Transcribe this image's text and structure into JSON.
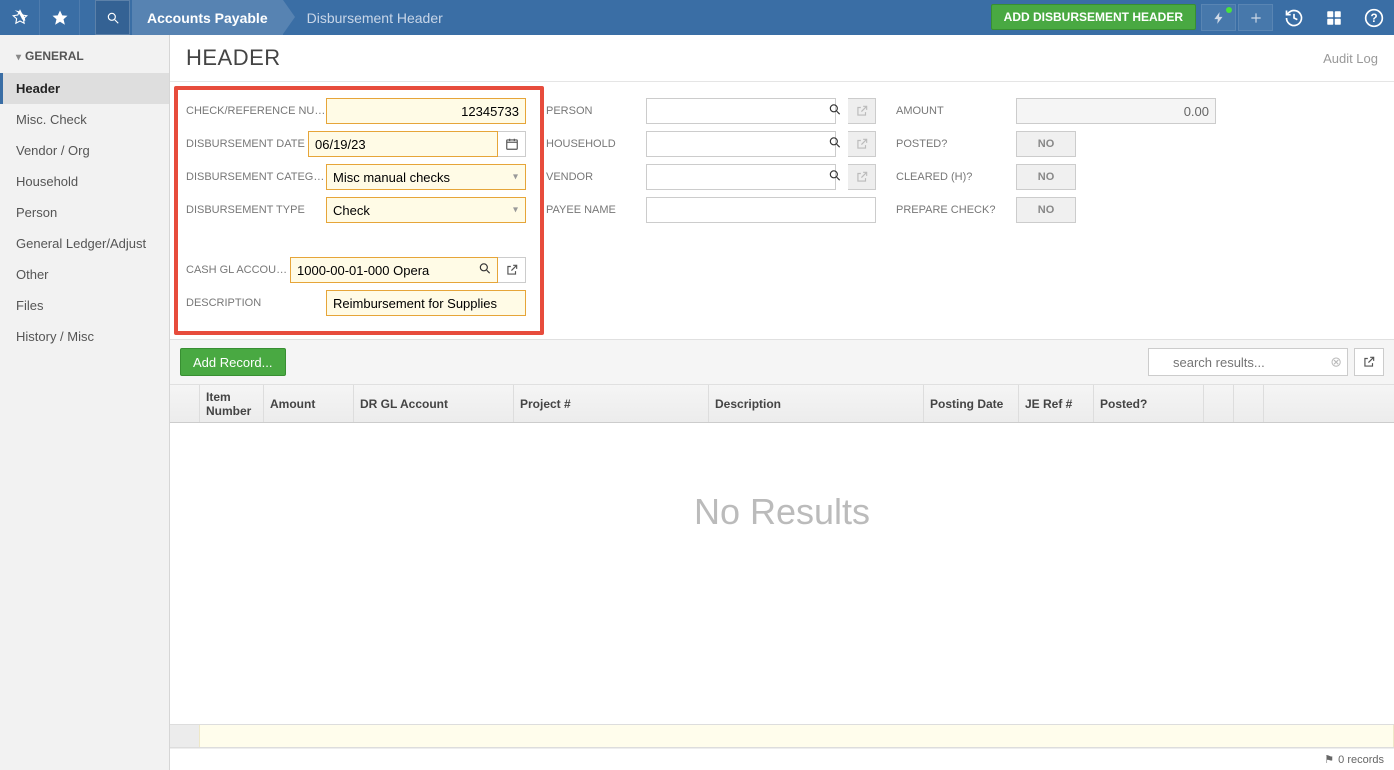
{
  "topbar": {
    "breadcrumb1": "Accounts Payable",
    "breadcrumb2": "Disbursement Header",
    "add_button": "ADD DISBURSEMENT HEADER"
  },
  "sidebar": {
    "header": "GENERAL",
    "items": [
      {
        "label": "Header",
        "active": true
      },
      {
        "label": "Misc. Check"
      },
      {
        "label": "Vendor / Org"
      },
      {
        "label": "Household"
      },
      {
        "label": "Person"
      },
      {
        "label": "General Ledger/Adjust"
      },
      {
        "label": "Other"
      },
      {
        "label": "Files"
      },
      {
        "label": "History / Misc"
      }
    ]
  },
  "page": {
    "title": "HEADER",
    "audit_log": "Audit Log"
  },
  "form": {
    "col1": {
      "check_ref_label": "CHECK/REFERENCE NUM...",
      "check_ref_value": "12345733",
      "date_label": "DISBURSEMENT DATE",
      "date_value": "06/19/23",
      "category_label": "DISBURSEMENT CATEGORY",
      "category_value": "Misc manual checks",
      "type_label": "DISBURSEMENT TYPE",
      "type_value": "Check",
      "cash_gl_label": "CASH GL ACCOUNT",
      "cash_gl_value": "1000-00-01-000 Opera",
      "description_label": "DESCRIPTION",
      "description_value": "Reimbursement for Supplies"
    },
    "col2": {
      "person_label": "PERSON",
      "household_label": "HOUSEHOLD",
      "vendor_label": "VENDOR",
      "payee_label": "PAYEE NAME"
    },
    "col3": {
      "amount_label": "AMOUNT",
      "amount_value": "0.00",
      "posted_label": "POSTED?",
      "posted_value": "NO",
      "cleared_label": "CLEARED (H)?",
      "cleared_value": "NO",
      "prepare_label": "PREPARE CHECK?",
      "prepare_value": "NO"
    }
  },
  "grid": {
    "add_record": "Add Record...",
    "search_placeholder": "search results...",
    "no_results": "No Results",
    "columns": [
      "",
      "Item Number",
      "Amount",
      "DR GL Account",
      "Project #",
      "Description",
      "Posting Date",
      "JE Ref #",
      "Posted?",
      "",
      "",
      ""
    ],
    "status": "0 records"
  }
}
